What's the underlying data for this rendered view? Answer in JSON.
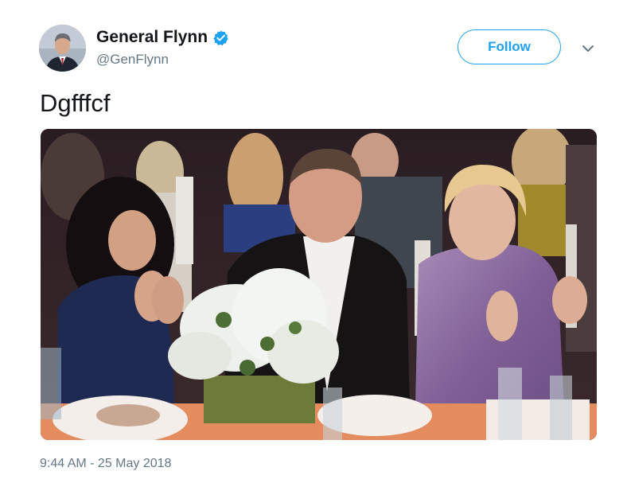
{
  "user": {
    "display_name": "General Flynn",
    "handle": "@GenFlynn",
    "verified": true,
    "avatar_icon": "profile-photo"
  },
  "follow_button": {
    "label": "Follow"
  },
  "menu": {
    "icon": "chevron-down-icon"
  },
  "tweet": {
    "text": "Dgfffcf",
    "timestamp": "9:44 AM - 25 May 2018"
  },
  "colors": {
    "brand_blue": "#1da1f2",
    "text_primary": "#14171a",
    "text_secondary": "#657786",
    "follow_border": "#1da1f2"
  }
}
